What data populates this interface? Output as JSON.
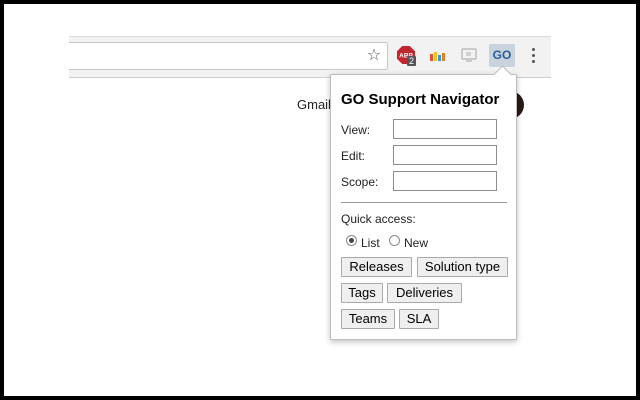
{
  "browser": {
    "extensions": {
      "abp_badge": "2",
      "abp_text": "ABP",
      "go_label": "GO"
    }
  },
  "page": {
    "gmail_link": "Gmail"
  },
  "popup": {
    "title": "GO Support Navigator",
    "fields": [
      {
        "label": "View:",
        "value": ""
      },
      {
        "label": "Edit:",
        "value": ""
      },
      {
        "label": "Scope:",
        "value": ""
      }
    ],
    "quick_access_label": "Quick access:",
    "radios": [
      {
        "label": "List",
        "checked": true
      },
      {
        "label": "New",
        "checked": false
      }
    ],
    "buttons": [
      "Releases",
      "Solution type",
      "Tags",
      "Deliveries",
      "Teams",
      "SLA"
    ]
  },
  "colors": {
    "go_icon_bg": "#c9d3de",
    "go_icon_text": "#2a5d9a",
    "abp_red": "#c0262d"
  }
}
